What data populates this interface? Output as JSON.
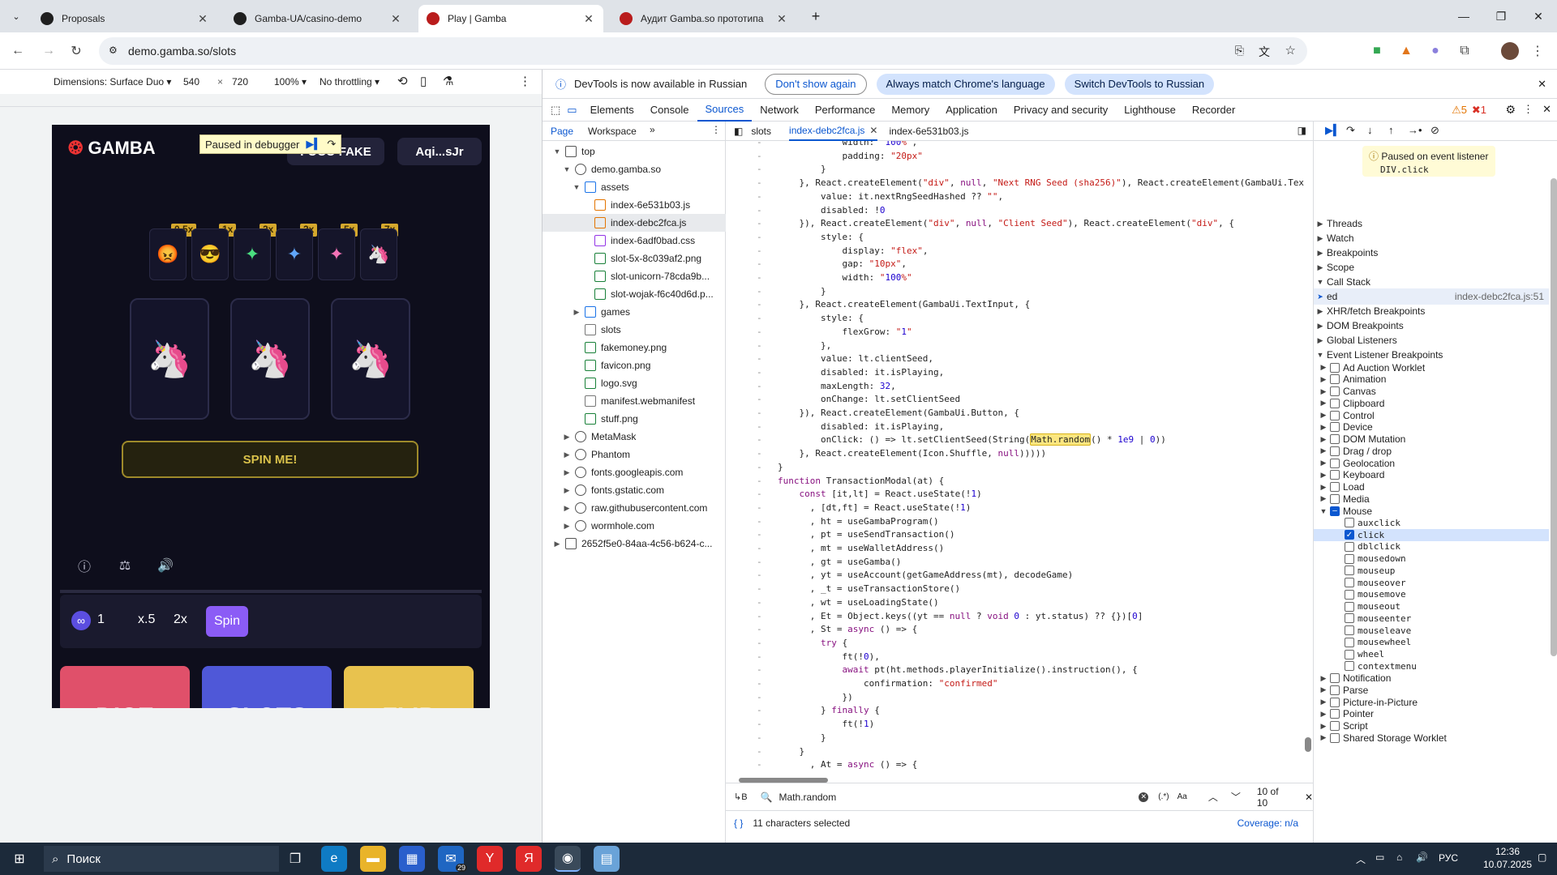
{
  "browser": {
    "tabs": [
      {
        "label": "Proposals",
        "icon": "upwork-icon",
        "color": "#1f1f1f"
      },
      {
        "label": "Gamba-UA/casino-demo",
        "icon": "github-icon",
        "color": "#1f1f1f"
      },
      {
        "label": "Play | Gamba",
        "icon": "gamba-icon",
        "color": "#b91c1c"
      },
      {
        "label": "Аудит Gamba.so прототипа",
        "icon": "gamba-icon",
        "color": "#b91c1c"
      }
    ],
    "url": "demo.gamba.so/slots"
  },
  "devicebar": {
    "dimensions": "Dimensions: Surface Duo",
    "width": "540",
    "x": "×",
    "height": "720",
    "zoom": "100%",
    "throttle": "No throttling"
  },
  "game": {
    "paused_label": "Paused in debugger",
    "balance_label": "FOCO FAKE",
    "wallet_label": "Aqi...sJr",
    "multipliers": [
      "0.5x",
      "1x",
      "2x",
      "3x",
      "5x",
      "7x"
    ],
    "spin_label": "SPIN ME!",
    "bet": {
      "wager": "1",
      "half": "x.5",
      "double": "2x",
      "spin": "Spin"
    },
    "cards": [
      "DICE",
      "SLOTS",
      "FLIP"
    ]
  },
  "devtools": {
    "info_text": "DevTools is now available in Russian",
    "dont_show": "Don't show again",
    "always_match": "Always match Chrome's language",
    "switch_ru": "Switch DevTools to Russian",
    "tabs": [
      "Elements",
      "Console",
      "Sources",
      "Network",
      "Performance",
      "Memory",
      "Application",
      "Privacy and security",
      "Lighthouse",
      "Recorder"
    ],
    "warn_count": "5",
    "err_count": "1",
    "nav_tabs": [
      "Page",
      "Workspace"
    ],
    "tree": [
      {
        "label": "top",
        "depth": 0,
        "type": "frame",
        "open": true
      },
      {
        "label": "demo.gamba.so",
        "depth": 1,
        "type": "cloud",
        "open": true
      },
      {
        "label": "assets",
        "depth": 2,
        "type": "folder",
        "open": true
      },
      {
        "label": "index-6e531b03.js",
        "depth": 3,
        "type": "js"
      },
      {
        "label": "index-debc2fca.js",
        "depth": 3,
        "type": "js",
        "selected": true
      },
      {
        "label": "index-6adf0bad.css",
        "depth": 3,
        "type": "css"
      },
      {
        "label": "slot-5x-8c039af2.png",
        "depth": 3,
        "type": "img"
      },
      {
        "label": "slot-unicorn-78cda9b...",
        "depth": 3,
        "type": "img"
      },
      {
        "label": "slot-wojak-f6c40d6d.p...",
        "depth": 3,
        "type": "img"
      },
      {
        "label": "games",
        "depth": 2,
        "type": "folder",
        "open": false
      },
      {
        "label": "slots",
        "depth": 2,
        "type": "file"
      },
      {
        "label": "fakemoney.png",
        "depth": 2,
        "type": "img"
      },
      {
        "label": "favicon.png",
        "depth": 2,
        "type": "img"
      },
      {
        "label": "logo.svg",
        "depth": 2,
        "type": "img"
      },
      {
        "label": "manifest.webmanifest",
        "depth": 2,
        "type": "file"
      },
      {
        "label": "stuff.png",
        "depth": 2,
        "type": "img"
      },
      {
        "label": "MetaMask",
        "depth": 1,
        "type": "cloud",
        "open": false
      },
      {
        "label": "Phantom",
        "depth": 1,
        "type": "cloud",
        "open": false
      },
      {
        "label": "fonts.googleapis.com",
        "depth": 1,
        "type": "cloud",
        "open": false
      },
      {
        "label": "fonts.gstatic.com",
        "depth": 1,
        "type": "cloud",
        "open": false
      },
      {
        "label": "raw.githubusercontent.com",
        "depth": 1,
        "type": "cloud",
        "open": false
      },
      {
        "label": "wormhole.com",
        "depth": 1,
        "type": "cloud",
        "open": false
      },
      {
        "label": "2652f5e0-84aa-4c56-b624-c...",
        "depth": 0,
        "type": "gear",
        "open": false
      }
    ],
    "editor_tabs": [
      "slots",
      "index-debc2fca.js",
      "index-6e531b03.js"
    ],
    "code": [
      "            width: \"100%\",",
      "            padding: \"20px\"",
      "        }",
      "    }, React.createElement(\"div\", null, \"Next RNG Seed (sha256)\"), React.createElement(GambaUi.Tex",
      "        value: it.nextRngSeedHashed ?? \"\",",
      "        disabled: !0",
      "    }), React.createElement(\"div\", null, \"Client Seed\"), React.createElement(\"div\", {",
      "        style: {",
      "            display: \"flex\",",
      "            gap: \"10px\",",
      "            width: \"100%\"",
      "        }",
      "    }, React.createElement(GambaUi.TextInput, {",
      "        style: {",
      "            flexGrow: \"1\"",
      "        },",
      "        value: lt.clientSeed,",
      "        disabled: it.isPlaying,",
      "        maxLength: 32,",
      "        onChange: lt.setClientSeed",
      "    }), React.createElement(GambaUi.Button, {",
      "        disabled: it.isPlaying,",
      "        onClick: () => lt.setClientSeed(String(Math.random() * 1e9 | 0))",
      "    }, React.createElement(Icon.Shuffle, null)))))",
      "}",
      "function TransactionModal(at) {",
      "    const [it,lt] = React.useState(!1)",
      "      , [dt,ft] = React.useState(!1)",
      "      , ht = useGambaProgram()",
      "      , pt = useSendTransaction()",
      "      , mt = useWalletAddress()",
      "      , gt = useGamba()",
      "      , yt = useAccount(getGameAddress(mt), decodeGame)",
      "      , _t = useTransactionStore()",
      "      , wt = useLoadingState()",
      "      , Et = Object.keys((yt == null ? void 0 : yt.status) ?? {})[0]",
      "      , St = async () => {",
      "        try {",
      "            ft(!0),",
      "            await pt(ht.methods.playerInitialize().instruction(), {",
      "                confirmation: \"confirmed\"",
      "            })",
      "        } finally {",
      "            ft(!1)",
      "        }",
      "    }",
      "      , At = async () => {"
    ],
    "search_query": "Math.random",
    "search_count": "10 of 10",
    "selected_chars": "11 characters selected",
    "coverage": "Coverage: n/a",
    "paused_msg": "Paused on event listener",
    "paused_target": "DIV.click",
    "sections": [
      "Threads",
      "Watch",
      "Breakpoints",
      "Scope",
      "Call Stack"
    ],
    "call_frame": {
      "name": "ed",
      "loc": "index-debc2fca.js:51"
    },
    "sections2": [
      "XHR/fetch Breakpoints",
      "DOM Breakpoints",
      "Global Listeners",
      "Event Listener Breakpoints"
    ],
    "listeners": [
      "Ad Auction Worklet",
      "Animation",
      "Canvas",
      "Clipboard",
      "Control",
      "Device",
      "DOM Mutation",
      "Drag / drop",
      "Geolocation",
      "Keyboard",
      "Load",
      "Media",
      "Mouse"
    ],
    "mouse_events": [
      "auxclick",
      "click",
      "dblclick",
      "mousedown",
      "mouseup",
      "mouseover",
      "mousemove",
      "mouseout",
      "mouseenter",
      "mouseleave",
      "mousewheel",
      "wheel",
      "contextmenu"
    ],
    "listeners2": [
      "Notification",
      "Parse",
      "Picture-in-Picture",
      "Pointer",
      "Script",
      "Shared Storage Worklet"
    ]
  },
  "taskbar": {
    "search": "Поиск",
    "lang": "РУС",
    "time": "12:36",
    "date": "10.07.2025",
    "mail_badge": "29"
  }
}
